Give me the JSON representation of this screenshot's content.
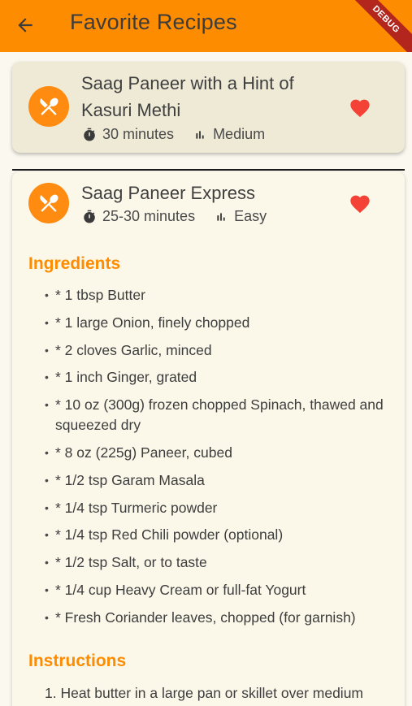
{
  "appbar": {
    "title": "Favorite Recipes",
    "back_icon": "arrow-left-icon",
    "debug_banner": "DEBUG",
    "color": "#fe8c00"
  },
  "recipes": [
    {
      "title": "Saag Paneer with a Hint of Kasuri Methi",
      "time": "30 minutes",
      "difficulty": "Medium",
      "favorite": true,
      "expanded": false
    },
    {
      "title": "Saag Paneer Express",
      "time": "25-30 minutes",
      "difficulty": "Easy",
      "favorite": true,
      "expanded": true,
      "ingredients_heading": "Ingredients",
      "ingredients": [
        "* 1 tbsp Butter",
        "* 1 large Onion, finely chopped",
        "* 2 cloves Garlic, minced",
        "* 1 inch Ginger, grated",
        "* 10 oz (300g) frozen chopped Spinach, thawed and squeezed dry",
        "* 8 oz (225g) Paneer, cubed",
        "* 1/2 tsp Garam Masala",
        "* 1/4 tsp Turmeric powder",
        "* 1/4 tsp Red Chili powder (optional)",
        "* 1/2 tsp Salt, or to taste",
        "* 1/4 cup Heavy Cream or full-fat Yogurt",
        "* Fresh Coriander leaves, chopped (for garnish)"
      ],
      "instructions_heading": "Instructions",
      "instructions": [
        "1. Heat butter in a large pan or skillet over medium"
      ]
    }
  ],
  "colors": {
    "accent": "#fe8c00",
    "heart": "#f44336",
    "card_collapsed": "#eeead6",
    "card_expanded": "#fbf8ea"
  }
}
